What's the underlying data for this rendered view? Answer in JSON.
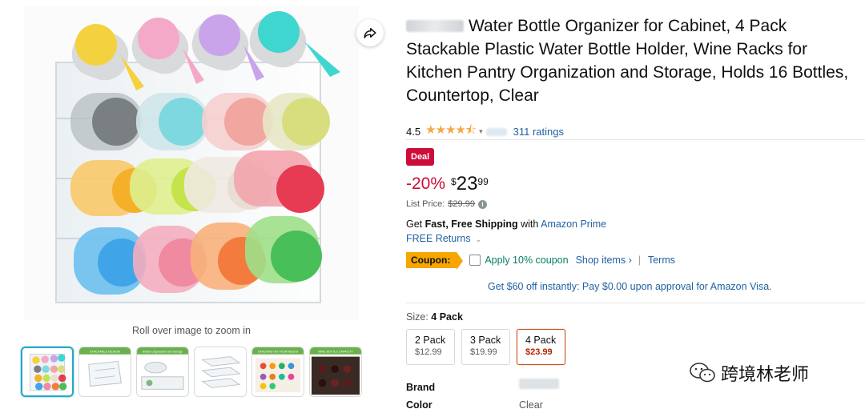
{
  "gallery": {
    "zoom_hint": "Roll over image to zoom in",
    "share_icon": "share-arrow-icon",
    "thumbnails": [
      {
        "name": "main-thumb"
      },
      {
        "name": "stackable-design",
        "caption": "STACKABLE DESIGN"
      },
      {
        "name": "organization-storage",
        "caption": "Bottles Organization and Storage"
      },
      {
        "name": "clear-rack"
      },
      {
        "name": "stacking-on-your-needs",
        "caption": "STACKING ON YOUR NEEDS"
      },
      {
        "name": "wine-bottle-capacity",
        "caption": "WINE BOTTLE CAPACITY"
      }
    ]
  },
  "product": {
    "title": "Water Bottle Organizer for Cabinet, 4 Pack Stackable Plastic Water Bottle Holder, Wine Racks for Kitchen Pantry Organization and Storage, Holds 16 Bottles, Countertop, Clear",
    "rating": "4.5",
    "stars": "★★★★⯪",
    "ratings_count": "311 ratings"
  },
  "pricing": {
    "deal_badge": "Deal",
    "discount": "-20%",
    "currency": "$",
    "price_whole": "23",
    "price_fraction": "99",
    "list_price_label": "List Price:",
    "list_price": "$29.99"
  },
  "shipping": {
    "prefix": "Get ",
    "bold": "Fast, Free Shipping",
    "middle": " with ",
    "link": "Amazon Prime",
    "returns": "FREE Returns"
  },
  "coupon": {
    "tag": "Coupon:",
    "text": "Apply 10% coupon",
    "shop_items": "Shop items ›",
    "pipe": "|",
    "terms": "Terms"
  },
  "visa_offer": "Get $60 off instantly: Pay $0.00 upon approval for Amazon Visa.",
  "size": {
    "label": "Size:",
    "selected": "4 Pack",
    "options": [
      {
        "name": "2 Pack",
        "price": "$12.99"
      },
      {
        "name": "3 Pack",
        "price": "$19.99"
      },
      {
        "name": "4 Pack",
        "price": "$23.99"
      }
    ]
  },
  "attributes": [
    {
      "label": "Brand",
      "value": ""
    },
    {
      "label": "Color",
      "value": "Clear"
    }
  ],
  "watermark": "跨境林老师",
  "colors": {
    "deal_red": "#cc0c39",
    "link_blue": "#2162a1",
    "coupon_orange": "#f7a500",
    "coupon_green": "#067d62",
    "selected_border": "#c7511f"
  }
}
